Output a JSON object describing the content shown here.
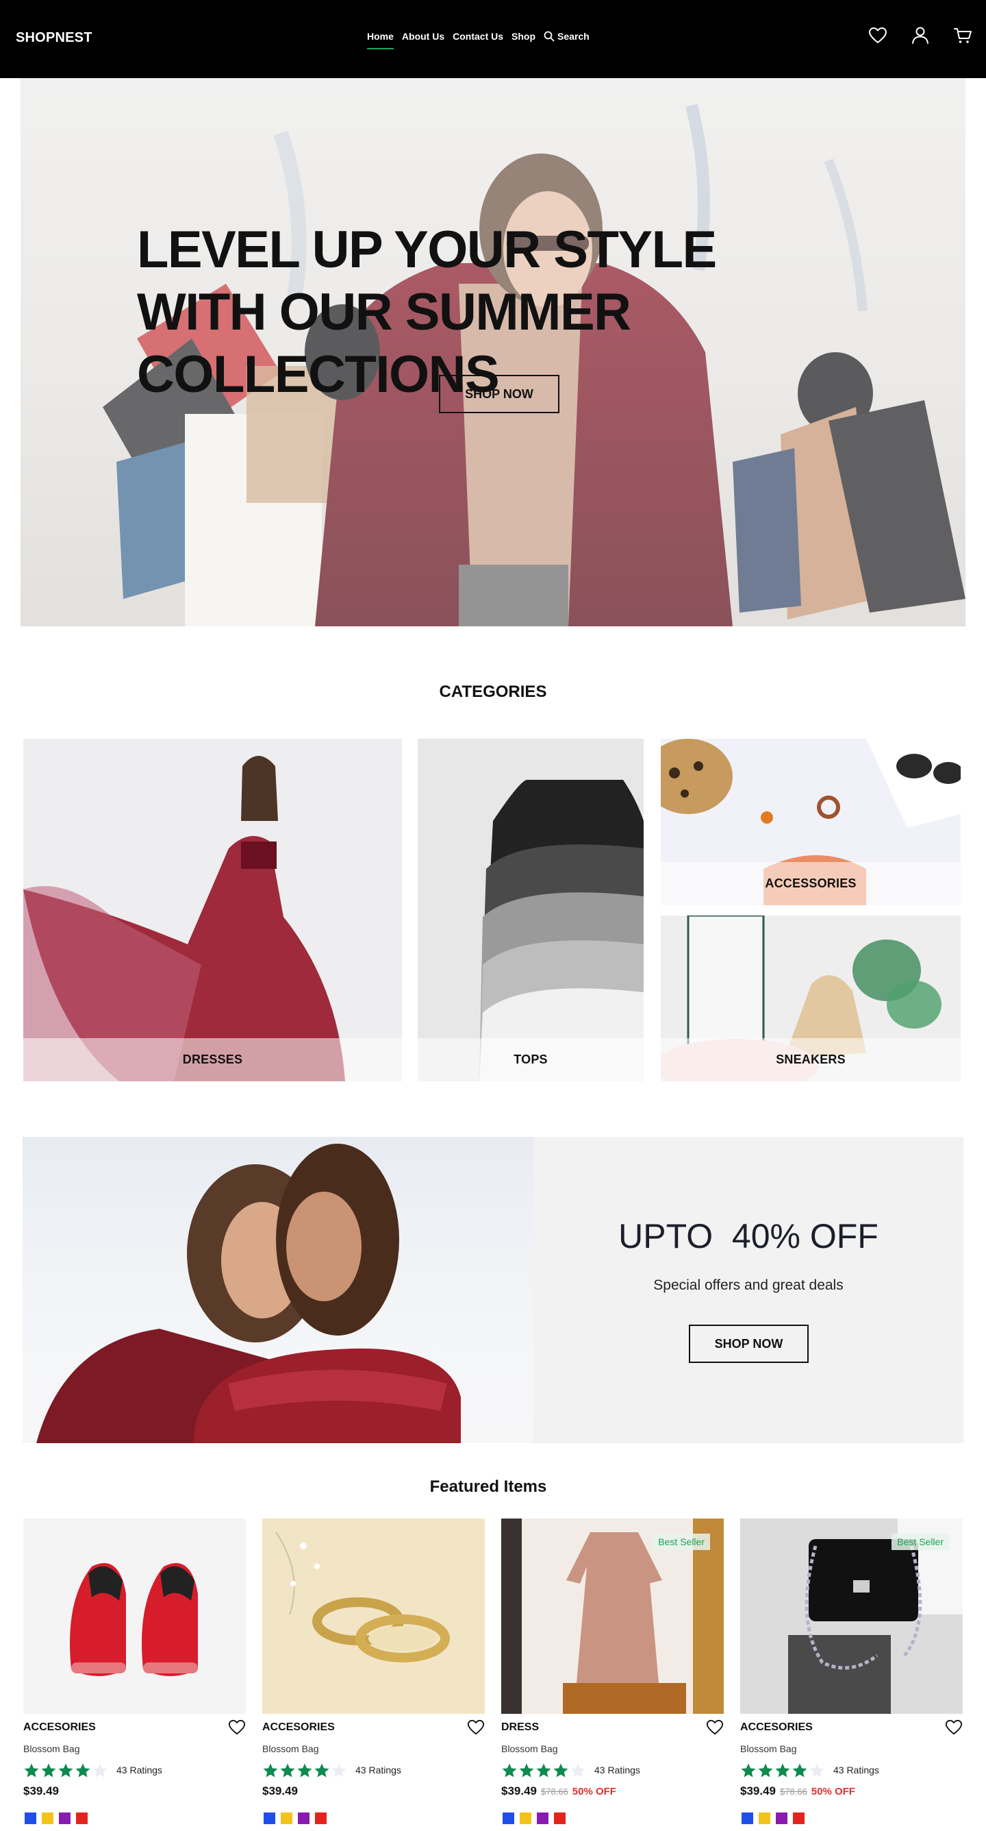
{
  "header": {
    "brand": "SHOPNEST",
    "nav": [
      {
        "label": "Home",
        "active": true
      },
      {
        "label": "About Us"
      },
      {
        "label": "Contact Us"
      },
      {
        "label": "Shop"
      }
    ],
    "search_label": "Search",
    "icons": [
      "heart-icon",
      "user-icon",
      "cart-icon"
    ]
  },
  "hero": {
    "title": "LEVEL UP YOUR STYLE WITH OUR SUMMER COLLECTIONS",
    "button": "SHOP NOW"
  },
  "categories": {
    "title": "CATEGORIES",
    "items": [
      "DRESSES",
      "TOPS",
      "ACCESSORIES",
      "SNEAKERS"
    ]
  },
  "promo": {
    "headline": "UPTO  40% OFF",
    "subtitle": "Special offers and great deals",
    "button": "SHOP NOW"
  },
  "featured": {
    "title": "Featured Items",
    "items": [
      {
        "category": "ACCESORIES",
        "name": "Blossom Bag",
        "rating": 4,
        "ratings_text": "43 Ratings",
        "price": "$39.49",
        "old_price": "",
        "discount": "",
        "badge": ""
      },
      {
        "category": "ACCESORIES",
        "name": "Blossom Bag",
        "rating": 4,
        "ratings_text": "43 Ratings",
        "price": "$39.49",
        "old_price": "",
        "discount": "",
        "badge": ""
      },
      {
        "category": "DRESS",
        "name": "Blossom Bag",
        "rating": 4,
        "ratings_text": "43 Ratings",
        "price": "$39.49",
        "old_price": "$78.66",
        "discount": "50% OFF",
        "badge": "Best Seller"
      },
      {
        "category": "ACCESORIES",
        "name": "Blossom Bag",
        "rating": 4,
        "ratings_text": "43 Ratings",
        "price": "$39.49",
        "old_price": "$78.66",
        "discount": "50% OFF",
        "badge": "Best Seller"
      }
    ],
    "swatch_colors": [
      "#1f4fe8",
      "#f2c31b",
      "#8a1bb0",
      "#e3241e"
    ]
  },
  "colors": {
    "header_bg": "#000000",
    "accent_green": "#22a35a",
    "star_green": "#0f8a4f",
    "sale_red": "#e23030"
  }
}
